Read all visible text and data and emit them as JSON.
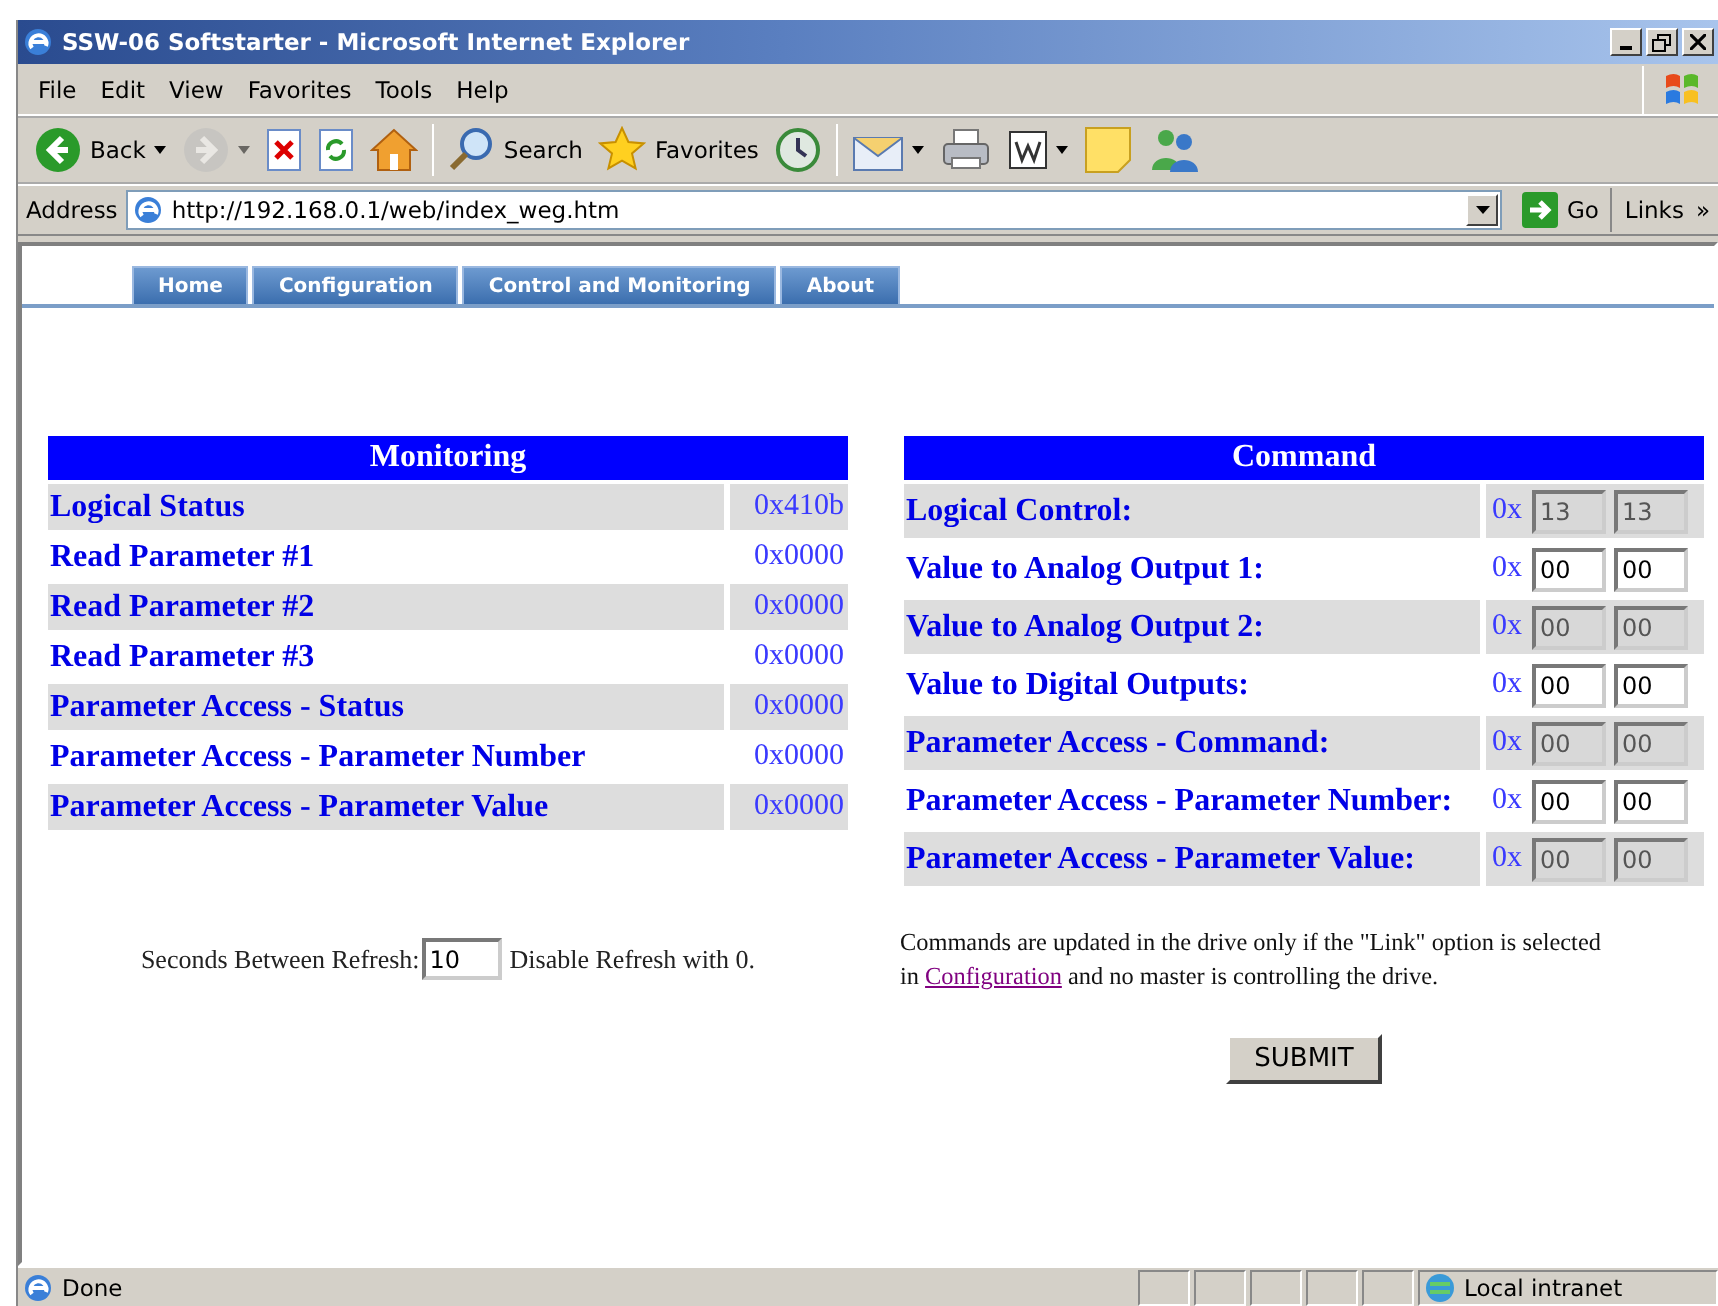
{
  "window": {
    "title": "SSW-06 Softstarter - Microsoft Internet Explorer"
  },
  "menu": [
    "File",
    "Edit",
    "View",
    "Favorites",
    "Tools",
    "Help"
  ],
  "toolbar": [
    {
      "kind": "back",
      "label": "Back",
      "caret": true,
      "disabled": false
    },
    {
      "kind": "forward",
      "caret": true,
      "disabled": true
    },
    {
      "kind": "stop",
      "caret": false,
      "disabled": false
    },
    {
      "kind": "refresh",
      "caret": false,
      "disabled": false
    },
    {
      "kind": "home",
      "caret": false,
      "disabled": false
    },
    {
      "kind": "separator"
    },
    {
      "kind": "search",
      "label": "Search",
      "caret": false,
      "disabled": false
    },
    {
      "kind": "favorites",
      "label": "Favorites",
      "caret": false,
      "disabled": false
    },
    {
      "kind": "history",
      "caret": false,
      "disabled": false
    },
    {
      "kind": "separator"
    },
    {
      "kind": "mail",
      "caret": true,
      "disabled": false
    },
    {
      "kind": "print",
      "caret": false,
      "disabled": false
    },
    {
      "kind": "edit",
      "caret": true,
      "disabled": false
    },
    {
      "kind": "note",
      "caret": false,
      "disabled": false
    },
    {
      "kind": "messenger",
      "caret": false,
      "disabled": false
    }
  ],
  "address": {
    "label": "Address",
    "value": "http://192.168.0.1/web/index_weg.htm",
    "go": "Go",
    "links": "Links",
    "more": "»"
  },
  "nav_tabs": [
    {
      "label": "Home"
    },
    {
      "label": "Configuration"
    },
    {
      "label": "Control and Monitoring"
    },
    {
      "label": "About"
    }
  ],
  "monitoring": {
    "title": "Monitoring",
    "rows": [
      {
        "label": "Logical Status",
        "value": "0x410b"
      },
      {
        "label": "Read Parameter #1",
        "value": "0x0000"
      },
      {
        "label": "Read Parameter #2",
        "value": "0x0000"
      },
      {
        "label": "Read Parameter #3",
        "value": "0x0000"
      },
      {
        "label": "Parameter Access - Status",
        "value": "0x0000"
      },
      {
        "label": "Parameter Access - Parameter Number",
        "value": "0x0000"
      },
      {
        "label": "Parameter Access - Parameter Value",
        "value": "0x0000"
      }
    ]
  },
  "refresh": {
    "label": "Seconds Between Refresh:",
    "value": "10",
    "note": "Disable Refresh with 0."
  },
  "command": {
    "title": "Command",
    "rows": [
      {
        "label": "Logical Control:",
        "prefix": "0x",
        "high": "13",
        "low": "13",
        "disabled": true
      },
      {
        "label": "Value to Analog Output 1:",
        "prefix": "0x",
        "high": "00",
        "low": "00",
        "disabled": false
      },
      {
        "label": "Value to Analog Output 2:",
        "prefix": "0x",
        "high": "00",
        "low": "00",
        "disabled": true
      },
      {
        "label": "Value to Digital Outputs:",
        "prefix": "0x",
        "high": "00",
        "low": "00",
        "disabled": false
      },
      {
        "label": "Parameter Access - Command:",
        "prefix": "0x",
        "high": "00",
        "low": "00",
        "disabled": true
      },
      {
        "label": "Parameter Access - Parameter Number:",
        "prefix": "0x",
        "high": "00",
        "low": "00",
        "disabled": false
      },
      {
        "label": "Parameter Access - Parameter Value:",
        "prefix": "0x",
        "high": "00",
        "low": "00",
        "disabled": true
      }
    ]
  },
  "note": {
    "before": "Commands are updated in the drive only if the \"Link\" option is selected in",
    "link": "Configuration",
    "after": "and no master is controlling the drive."
  },
  "submit": "SUBMIT",
  "status_bar": {
    "text": "Done",
    "zone": "Local intranet"
  }
}
